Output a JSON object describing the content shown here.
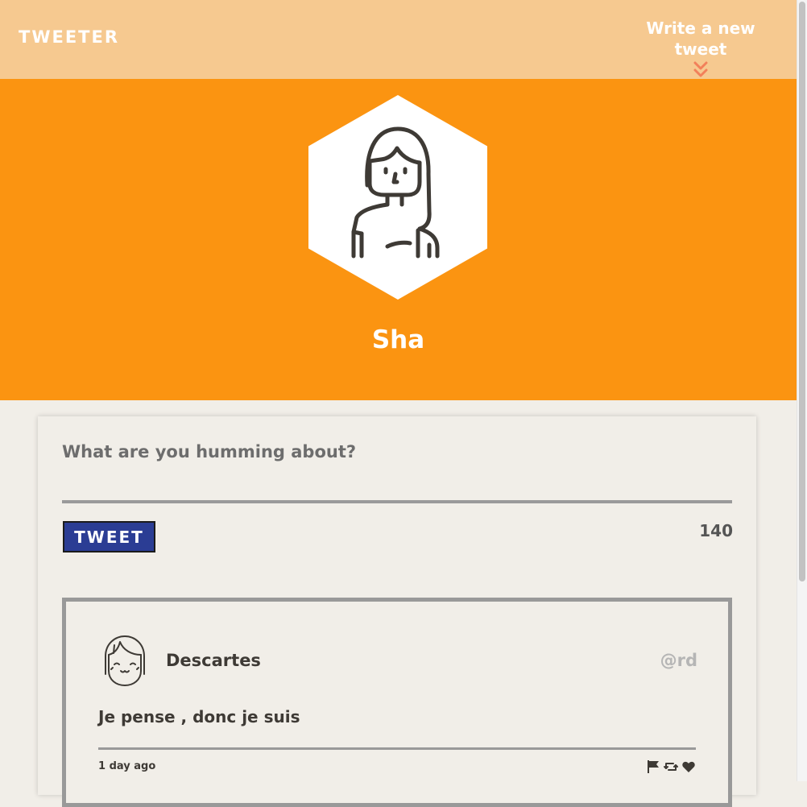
{
  "nav": {
    "brand": "TWEETER",
    "compose_label": "Write a new tweet",
    "compose_arrow_icon": "double-chevron-down-icon"
  },
  "profile": {
    "username": "Sha",
    "avatar_icon": "person-avatar-icon"
  },
  "compose": {
    "placeholder": "What are you humming about?",
    "button_label": "TWEET",
    "char_counter": "140"
  },
  "tweet": {
    "author_name": "Descartes",
    "author_handle": "@rd",
    "avatar_icon": "smiling-face-avatar-icon",
    "content": "Je pense , donc je suis",
    "timestamp": "1 day ago",
    "actions": [
      "flag-icon",
      "retweet-icon",
      "heart-icon"
    ]
  },
  "colors": {
    "nav_bg": "#f6c990",
    "profile_bg": "#fb9411",
    "page_bg": "#f1eee8",
    "button_bg": "#2b3d94",
    "arrow_color": "#f2805a",
    "text_dark": "#3e3a35",
    "handle_gray": "#b5b5b5"
  }
}
